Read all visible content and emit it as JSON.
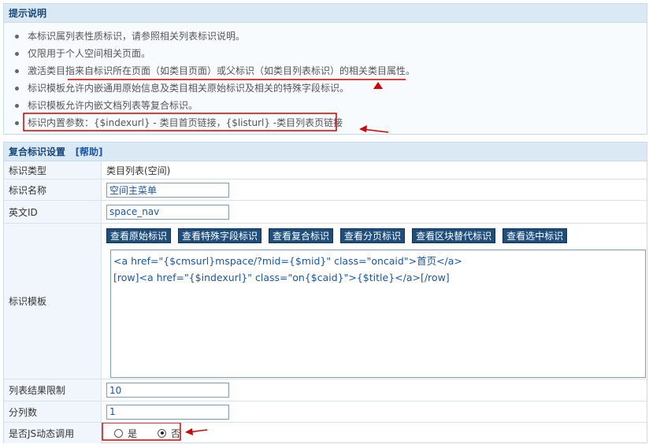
{
  "tips": {
    "title": "提示说明",
    "items": [
      "本标识属列表性质标识，请参照相关列表标识说明。",
      "仅限用于个人空间相关页面。",
      "激活类目指来自标识所在页面（如类目页面）或父标识（如类目列表标识）的相关类目属性。",
      "标识模板允许内嵌通用原始信息及类目相关原始标识及相关的特殊字段标识。",
      "标识模板允许内嵌文档列表等复合标识。",
      "标识内置参数：{$indexurl} - 类目首页链接，{$listurl} -类目列表页链接"
    ]
  },
  "form": {
    "title": "复合标识设置",
    "help_link": "[帮助]",
    "rows": {
      "type_label": "标识类型",
      "type_value": "类目列表(空间)",
      "name_label": "标识名称",
      "name_value": "空间主菜单",
      "ename_label": "英文ID",
      "ename_value": "space_nav",
      "template_label": "标识模板",
      "template_value": "<a href=\"{$cmsurl}mspace/?mid={$mid}\" class=\"oncaid\">首页</a>\n[row]<a href=\"{$indexurl}\" class=\"on{$caid}\">{$title}</a>[/row]",
      "limit_label": "列表结果限制",
      "limit_value": "10",
      "cols_label": "分列数",
      "cols_value": "1",
      "js_label": "是否JS动态调用",
      "js_yes": "是",
      "js_no": "否",
      "js_selected": "否"
    },
    "buttons": [
      "查看原始标识",
      "查看特殊字段标识",
      "查看复合标识",
      "查看分页标识",
      "查看区块替代标识",
      "查看选中标识"
    ]
  },
  "colors": {
    "header_bg": "#dbe9f5",
    "header_text": "#174a7c",
    "button_bg": "#1e4f7c",
    "annotation_red": "#d40000",
    "input_text": "#1a56a8"
  }
}
